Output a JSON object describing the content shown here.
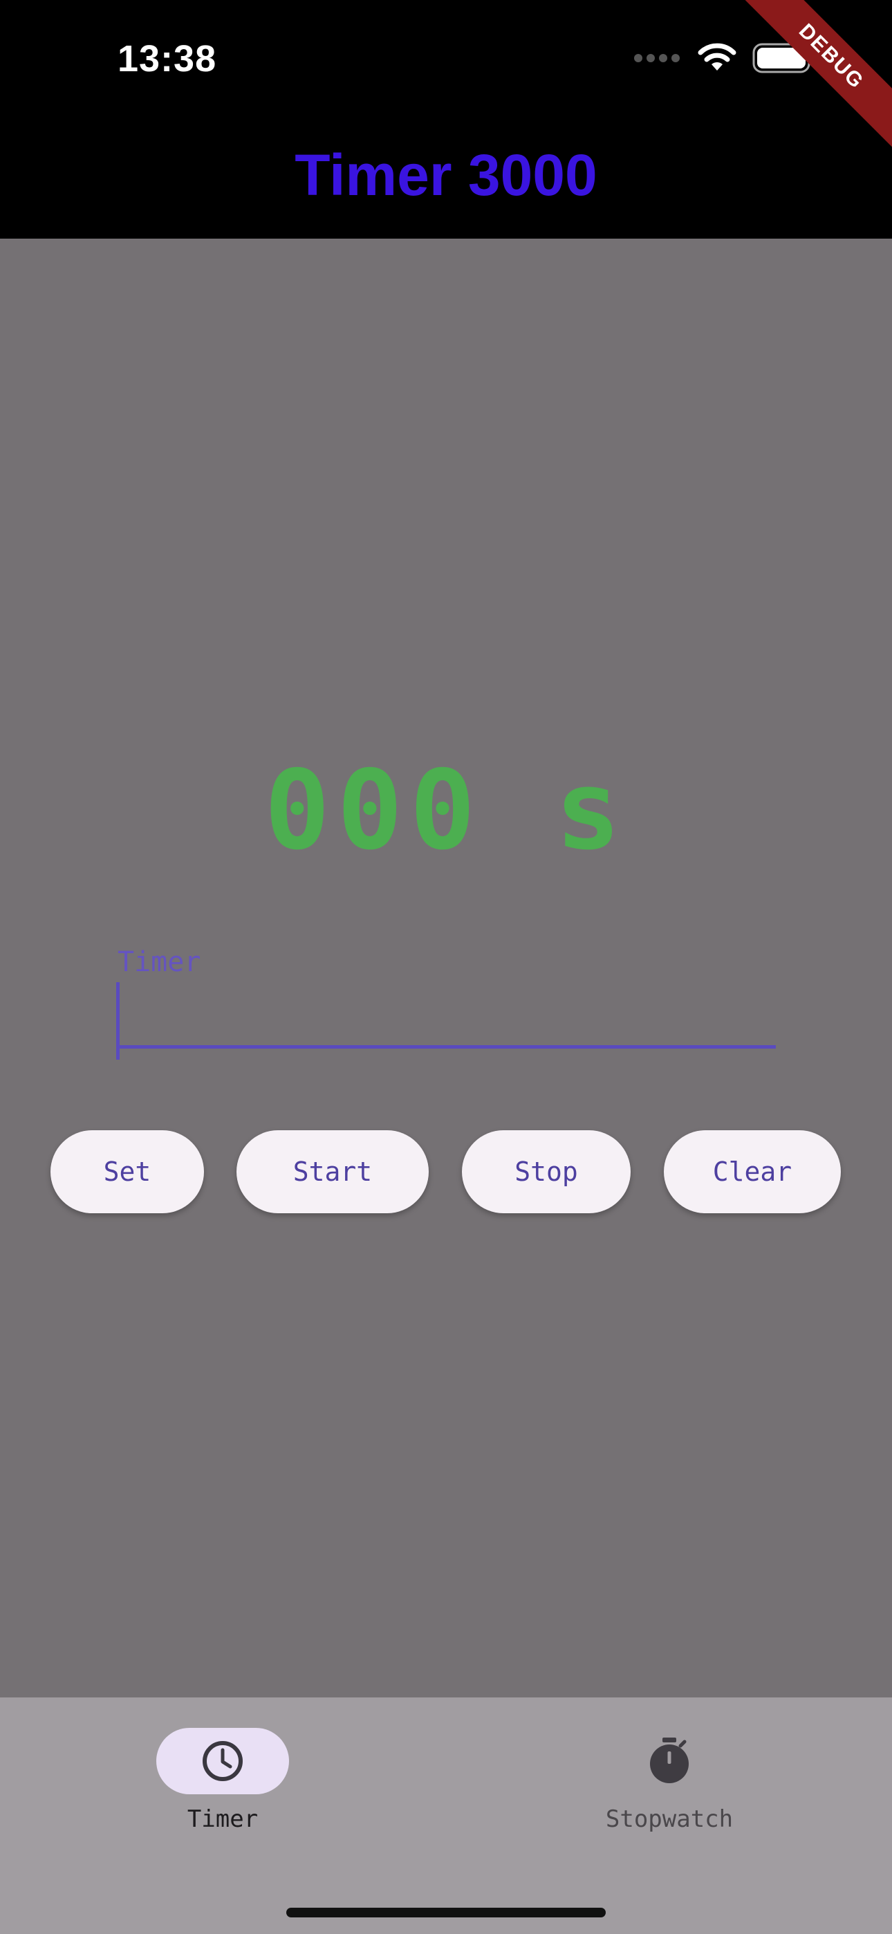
{
  "status_bar": {
    "time": "13:38"
  },
  "debug_banner": "DEBUG",
  "app_bar": {
    "title": "Timer 3000",
    "title_color": "#3a14e0"
  },
  "timer": {
    "display": "000 s",
    "color": "#4caf50"
  },
  "input": {
    "label": "Timer",
    "value": ""
  },
  "buttons": {
    "set": "Set",
    "start": "Start",
    "stop": "Stop",
    "clear": "Clear"
  },
  "bottom_nav": {
    "items": [
      {
        "label": "Timer",
        "icon": "clock-icon",
        "selected": true
      },
      {
        "label": "Stopwatch",
        "icon": "stopwatch-icon",
        "selected": false
      }
    ]
  },
  "colors": {
    "background": "#757174",
    "accent": "#5a4bbf",
    "nav_background": "#a19da1",
    "selected_pill": "#e9e0f5"
  }
}
